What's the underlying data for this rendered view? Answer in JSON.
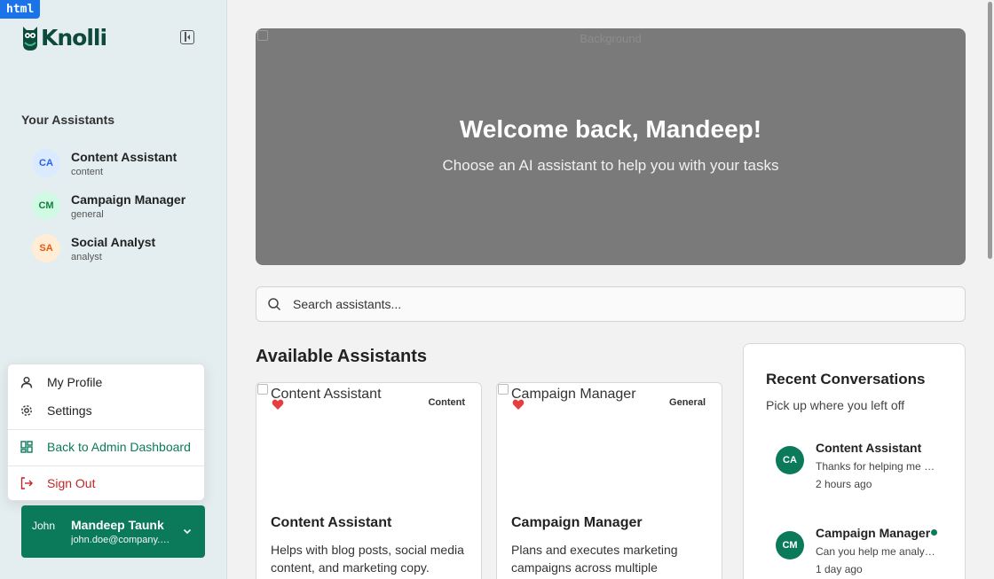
{
  "devtools": {
    "tag": "html"
  },
  "brand": {
    "name": "Knolli"
  },
  "sidebar": {
    "section_title": "Your Assistants",
    "assistants": [
      {
        "initials": "CA",
        "name": "Content Assistant",
        "category": "content"
      },
      {
        "initials": "CM",
        "name": "Campaign Manager",
        "category": "general"
      },
      {
        "initials": "SA",
        "name": "Social Analyst",
        "category": "analyst"
      }
    ]
  },
  "user_menu": {
    "items": [
      {
        "label": "My Profile",
        "icon": "user-icon"
      },
      {
        "label": "Settings",
        "icon": "gear-icon"
      },
      {
        "label": "Back to Admin Dashboard",
        "icon": "dashboard-icon"
      },
      {
        "label": "Sign Out",
        "icon": "sign-out-icon"
      }
    ]
  },
  "user": {
    "avatar_alt": "John",
    "name": "Mandeep Taunk",
    "email": "john.doe@company.com"
  },
  "hero": {
    "image_alt": "Background",
    "title": "Welcome back, Mandeep!",
    "subtitle": "Choose an AI assistant to help you with your tasks"
  },
  "search": {
    "placeholder": "Search assistants..."
  },
  "available": {
    "title": "Available Assistants",
    "cards": [
      {
        "image_alt": "Content Assistant",
        "tag": "Content",
        "title": "Content Assistant",
        "description": "Helps with blog posts, social media content, and marketing copy."
      },
      {
        "image_alt": "Campaign Manager",
        "tag": "General",
        "title": "Campaign Manager",
        "description": "Plans and executes marketing campaigns across multiple"
      }
    ]
  },
  "recent": {
    "title": "Recent Conversations",
    "subtitle": "Pick up where you left off",
    "conversations": [
      {
        "initials": "CA",
        "name": "Content Assistant",
        "message": "Thanks for helping me with the blog post!",
        "time": "2 hours ago",
        "unread": false
      },
      {
        "initials": "CM",
        "name": "Campaign Manager",
        "message": "Can you help me analyze the campaign?",
        "time": "1 day ago",
        "unread": true
      }
    ]
  },
  "colors": {
    "accent": "#0b7a5a",
    "danger": "#c02626",
    "sidebar_bg": "#e4eef0",
    "hero_bg": "#7a7a7a"
  }
}
